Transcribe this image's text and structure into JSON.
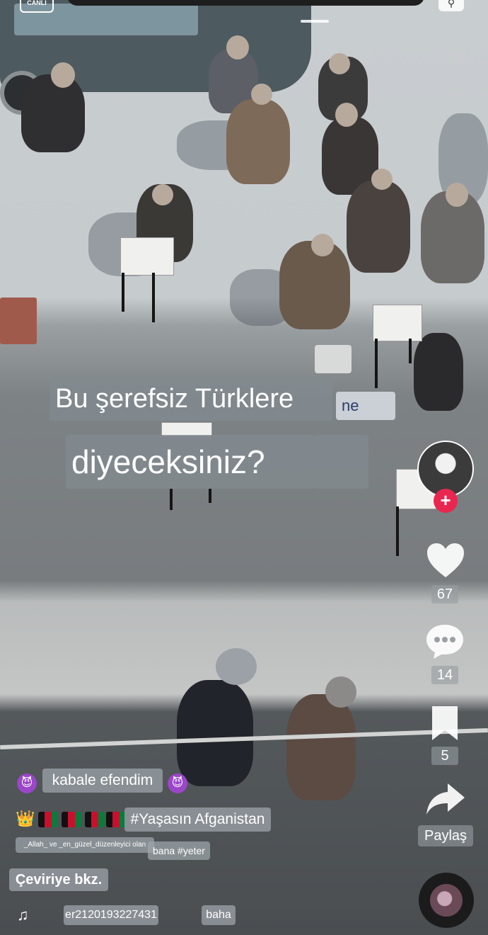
{
  "status": {
    "live_badge": "CANLI"
  },
  "caption": {
    "line1": "Bu şerefsiz Türklere",
    "line1_suffix": "ne",
    "line2": "diyeceksiniz?"
  },
  "actions": {
    "likes": "67",
    "comments": "14",
    "saves": "5",
    "share_label": "Paylaş"
  },
  "description": {
    "tag_kabale": "kabale efendim",
    "emoji_devil": "😈",
    "emoji_crown": "👑",
    "hashtag": "#Yaşasın Afganistan",
    "small_tag": "_Allah_ ve _en_güzel_düzenleyici olan",
    "small_tag2": "bana #yeter",
    "translate_label": "Çeviriye bkz."
  },
  "music": {
    "username": "er2120193227431",
    "sound": "baha"
  },
  "colors": {
    "like_color": "#ffffff",
    "follow_badge": "#e8264f",
    "flag_black": "#111111",
    "flag_red": "#c8102e",
    "flag_green": "#0b7a3b"
  },
  "icons": [
    "search-icon",
    "heart-icon",
    "comment-icon",
    "bookmark-icon",
    "share-icon",
    "music-note-icon",
    "plus-icon"
  ]
}
